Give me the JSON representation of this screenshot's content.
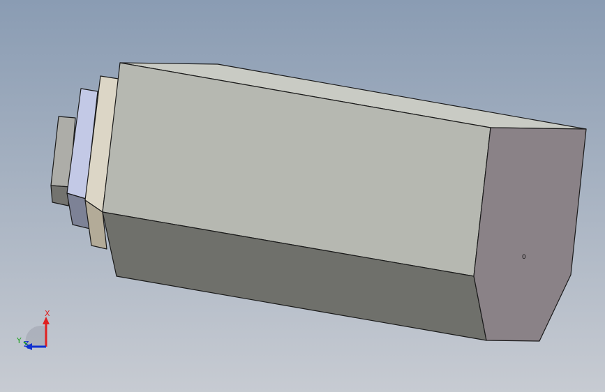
{
  "viewport": {
    "background_top": "#8a9cb3",
    "background_bottom": "#c7cbd2"
  },
  "model": {
    "face_label": "0",
    "colors": {
      "top": "#c9cbc4",
      "front": "#b6b8b1",
      "bottom": "#6f706b",
      "end": "#8a8287",
      "collar_top": "#dcd6c6",
      "collar_side": "#b3ab98",
      "blue_top": "#c3c9e6",
      "blue_side": "#7d8296",
      "shaft_top": "#adada8",
      "shaft_side": "#73736f",
      "edge": "#1a1a1a"
    }
  },
  "triad": {
    "x_label": "X",
    "y_label": "Y",
    "z_label": "Z",
    "x_color": "#e02020",
    "y_color": "#1fa01f",
    "z_color": "#1030d0"
  }
}
